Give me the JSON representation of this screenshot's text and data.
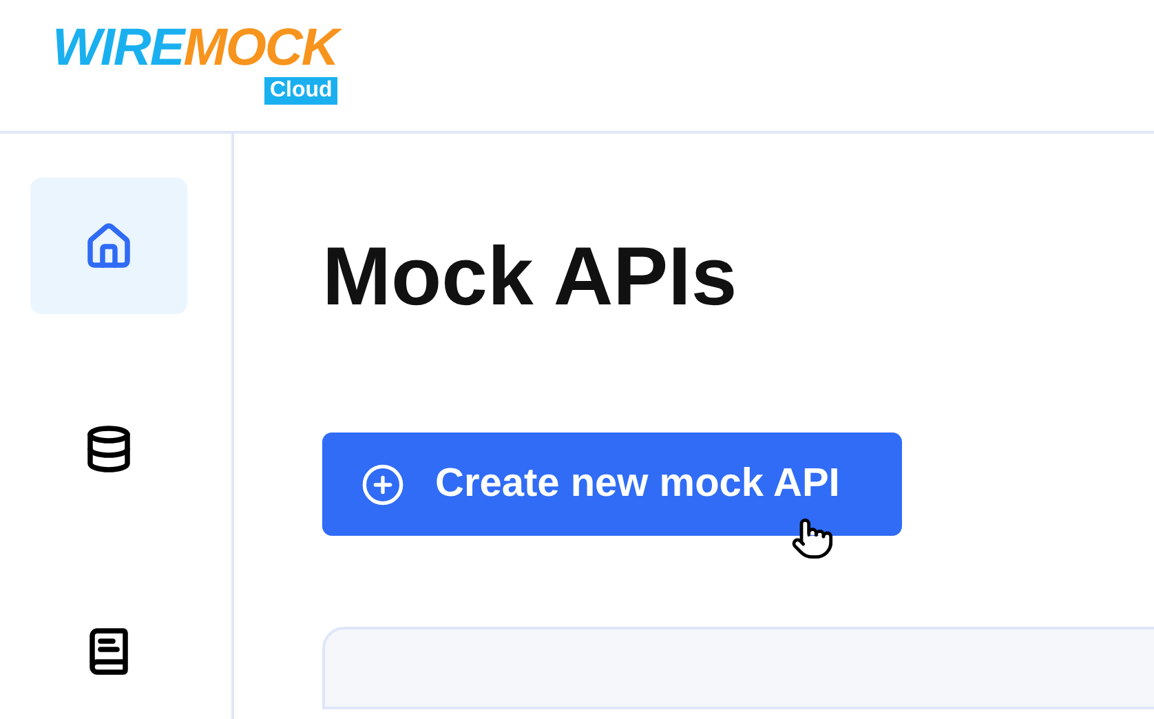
{
  "logo": {
    "word_1": "WIRE",
    "word_2": "MOCK",
    "badge": "Cloud"
  },
  "sidebar": {
    "items": [
      {
        "kind": "home",
        "selected": true
      },
      {
        "kind": "database",
        "selected": false
      },
      {
        "kind": "book",
        "selected": false
      }
    ]
  },
  "page": {
    "title": "Mock APIs",
    "create_button": "Create new mock API"
  }
}
